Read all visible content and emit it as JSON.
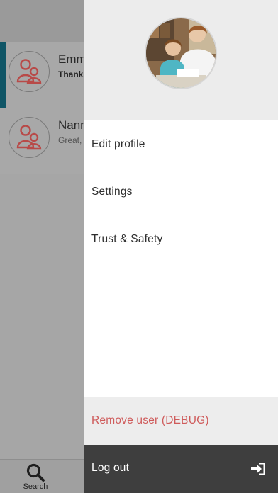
{
  "conversations": [
    {
      "name": "Emm",
      "snippet": "Thanks"
    },
    {
      "name": "Nann",
      "snippet": "Great,"
    }
  ],
  "tabbar": {
    "search_label": "Search",
    "search_icon": "search-icon"
  },
  "drawer": {
    "menu": [
      {
        "label": "Edit profile"
      },
      {
        "label": "Settings"
      },
      {
        "label": "Trust & Safety"
      }
    ],
    "debug_label": "Remove user (DEBUG)",
    "logout_label": "Log out",
    "logout_icon": "sign-in-icon"
  },
  "colors": {
    "accent": "#0f5566",
    "debug_text": "#cf5b5b",
    "logout_bg": "#3e3e3e",
    "avatar_icon": "#c0504d"
  }
}
